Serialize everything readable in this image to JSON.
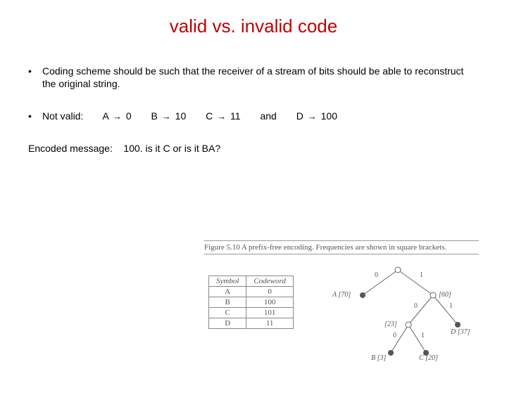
{
  "title": "valid vs. invalid code",
  "bullets": {
    "intro": "Coding scheme should be such that the receiver of a stream of bits should be able to reconstruct the original string.",
    "not_valid_label": "Not valid:",
    "mappings": [
      {
        "sym": "A",
        "code": "0"
      },
      {
        "sym": "B",
        "code": "10"
      },
      {
        "sym": "C",
        "code": "11"
      },
      {
        "sym": "D",
        "code": "100"
      }
    ],
    "and_label": "and"
  },
  "encoded_line": {
    "prefix": "Encoded message:",
    "text": "100. is it C or is it BA?"
  },
  "figure": {
    "caption": "Figure 5.10   A prefix-free encoding. Frequencies are shown in square brackets.",
    "table": {
      "headers": [
        "Symbol",
        "Codeword"
      ],
      "rows": [
        [
          "A",
          "0"
        ],
        [
          "B",
          "100"
        ],
        [
          "C",
          "101"
        ],
        [
          "D",
          "11"
        ]
      ]
    },
    "tree": {
      "edge_labels": {
        "l": "0",
        "r": "1"
      },
      "leaves": {
        "A": "A  [70]",
        "internal_right": "[60]",
        "internal_lr": "[23]",
        "D": "D  [37]",
        "B": "B  [3]",
        "C": "C  [20]"
      }
    }
  }
}
